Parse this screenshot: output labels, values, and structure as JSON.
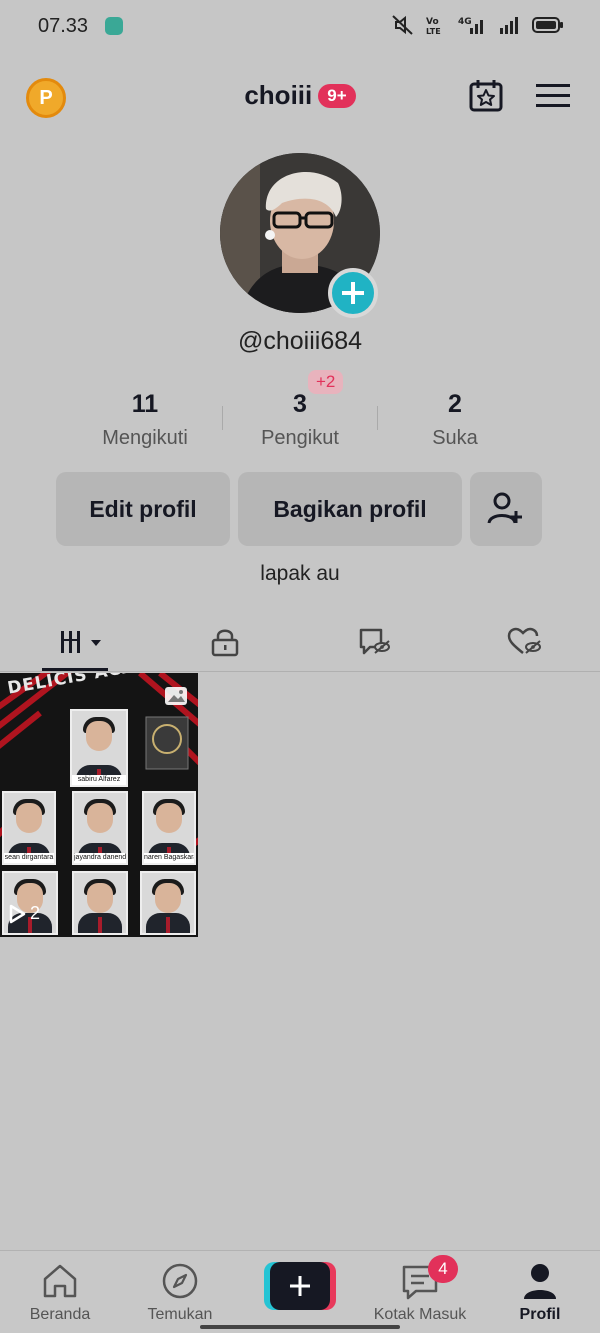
{
  "status_bar": {
    "time": "07.33",
    "network": "4G",
    "volte": "Vo LTE"
  },
  "header": {
    "username": "choiii",
    "notif_badge": "9+",
    "coin_letter": "P"
  },
  "profile": {
    "handle": "@choiii684",
    "bio": "lapak au",
    "stats": [
      {
        "value": "11",
        "label": "Mengikuti"
      },
      {
        "value": "3",
        "label": "Pengikut"
      },
      {
        "value": "2",
        "label": "Suka"
      }
    ],
    "new_followers_badge": "+2"
  },
  "actions": {
    "edit": "Edit profil",
    "share": "Bagikan profil"
  },
  "tabs": [
    "videos-grid-icon",
    "lock-icon",
    "tagged-icon",
    "liked-icon"
  ],
  "videos": [
    {
      "title": "DELICIS ACADEMY",
      "views": "2",
      "captions": [
        "sabiru Alfarez",
        "sean dirgantara",
        "jayandra danendra",
        "naren Bagaskara"
      ]
    }
  ],
  "bottom_nav": {
    "items": [
      {
        "label": "Beranda",
        "icon": "home-icon"
      },
      {
        "label": "Temukan",
        "icon": "compass-icon"
      },
      {
        "label": "",
        "icon": "plus-icon"
      },
      {
        "label": "Kotak Masuk",
        "icon": "inbox-icon"
      },
      {
        "label": "Profil",
        "icon": "profile-icon"
      }
    ],
    "inbox_badge": "4"
  },
  "colors": {
    "accent": "#e2315a",
    "teal": "#20b3c4",
    "background": "#c6c6c6"
  }
}
